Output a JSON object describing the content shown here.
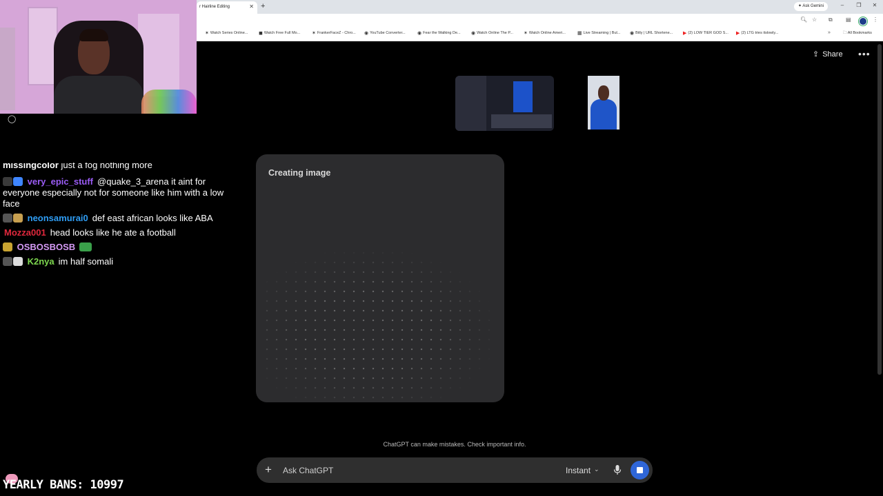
{
  "browser": {
    "tab_title": "r Hairline Editing",
    "new_tab": "+",
    "gemini": "Ask Gemini",
    "bookmarks": [
      "Watch Series Online...",
      "Watch Free Full Mo...",
      "FrankerFaceZ - Chro...",
      "YouTube Converter...",
      "Fear the Walking De...",
      "Watch Online The P...",
      "Watch Online Ameri...",
      "Live Streaming | Bul...",
      "Bitly | URL Shortene...",
      "(2) LOW TIER GOD S...",
      "(2) LTG tries itslowly..."
    ],
    "all_bookmarks": "All Bookmarks"
  },
  "chat": {
    "cut_line_user": "missingcolor",
    "cut_line_text": "just a fog nothing more",
    "messages": [
      {
        "user": "very_epic_stuff",
        "color": "#9b5cf6",
        "text": "@quake_3_arena it aint for everyone especially not for someone like him with a low face",
        "badges": [
          "#3a3a3a",
          "#3f86ff"
        ]
      },
      {
        "user": "neonsamurai0",
        "color": "#2f9df4",
        "text": "def east african looks like ABA",
        "badges": [
          "#555",
          "#c8a050"
        ]
      },
      {
        "user": "Mozza001",
        "color": "#e0283d",
        "text": "head looks like he ate a football",
        "badges": []
      },
      {
        "user": "OSBOSBOSB",
        "color": "#d59af5",
        "text": "",
        "badges": [
          "#c9a431"
        ],
        "emote": "#3aa04a"
      },
      {
        "user": "K2nya",
        "color": "#7ed84f",
        "text": "im half somali",
        "badges": [
          "#555",
          "#ddd"
        ]
      }
    ]
  },
  "overlay": {
    "yearly_bans": "YEARLY BANS: 10997"
  },
  "chatgpt": {
    "share_label": "Share",
    "more_label": "•••",
    "image_status": "Creating image",
    "disclaimer": "ChatGPT can make mistakes. Check important info.",
    "prompt_placeholder": "Ask ChatGPT",
    "model_label": "Instant"
  }
}
